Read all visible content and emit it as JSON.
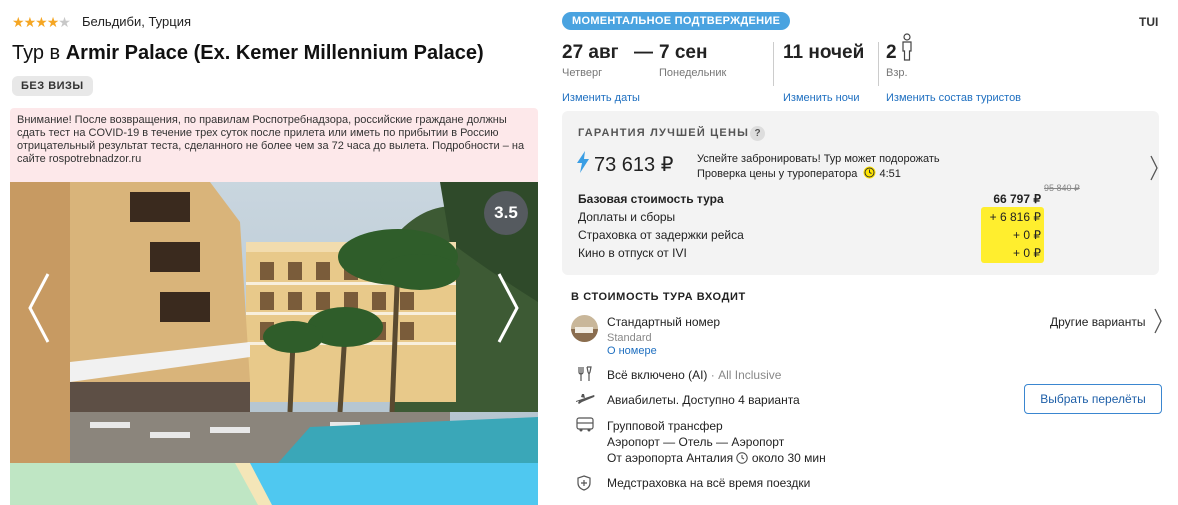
{
  "hotel": {
    "stars": 4,
    "location": "Бельдиби, Турция",
    "title_prefix": "Тур в ",
    "title_name": "Armir Palace (Ex. Kemer Millennium Palace)",
    "visa_badge": "БЕЗ ВИЗЫ",
    "warning": "Внимание! После возвращения, по правилам Роспотребнадзора, российские граждане должны сдать тест на COVID-19 в течение трех суток после прилета или иметь по прибытии в Россию отрицательный результат теста, сделанного не более чем за 72 часа до вылета. Подробности – на сайте rospotrebnadzor.ru",
    "rating": "3.5"
  },
  "header": {
    "instant_badge": "МОМЕНТАЛЬНОЕ ПОДТВЕРЖДЕНИЕ",
    "operator": "TUI",
    "date_from": "27 авг",
    "date_dash": "—",
    "date_to": "7 сен",
    "day_from": "Четверг",
    "day_to": "Понедельник",
    "nights": "11 ночей",
    "tourists": "2",
    "tourists_type": "Взр.",
    "link_dates": "Изменить даты",
    "link_nights": "Изменить ночи",
    "link_tourists": "Изменить состав туристов"
  },
  "price": {
    "guarantee": "ГАРАНТИЯ ЛУЧШЕЙ ЦЕНЫ",
    "question": "?",
    "total": "73 613 ₽",
    "notice_line1": "Успейте забронировать! Тур может подорожать",
    "notice_line2": "Проверка цены у туроператора",
    "timer": "4:51",
    "base_label": "Базовая стоимость тура",
    "base_value": "66 797 ₽",
    "base_old": "95 840 ₽",
    "rows": [
      {
        "label": "Доплаты и сборы",
        "value": "+ 6 816 ₽"
      },
      {
        "label": "Страховка от задержки рейса",
        "value": "+ 0 ₽"
      },
      {
        "label": "Кино в отпуск от IVI",
        "value": "+ 0 ₽"
      }
    ]
  },
  "includes": {
    "title": "В СТОИМОСТЬ ТУРА ВХОДИТ",
    "room": "Стандартный номер",
    "room_sub": "Standard",
    "room_link": "О номере",
    "other_variants": "Другие варианты",
    "meal_main": "Всё включено (AI)",
    "meal_sep": " · ",
    "meal_sub": "All Inclusive",
    "flights": "Авиабилеты. Доступно 4 варианта",
    "flights_button": "Выбрать перелёты",
    "transfer": "Групповой трансфер",
    "transfer_route": "Аэропорт — Отель — Аэропорт",
    "transfer_from": "От аэропорта Анталия",
    "transfer_time": "около 30 мин",
    "insurance": "Медстраховка на всё время поездки"
  },
  "colors": {
    "accent": "#4aa3e0",
    "link": "#1e6fc0",
    "highlight": "#ffee2e",
    "warning_bg": "#fde8ea"
  }
}
